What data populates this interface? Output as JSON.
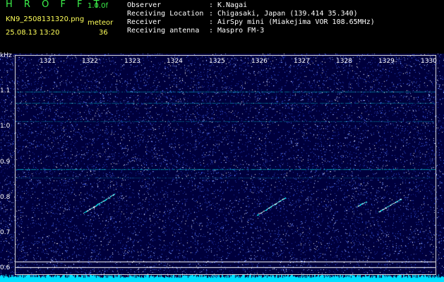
{
  "header": {
    "app_title": "H R O F F T",
    "version": "1.0.0f",
    "filename": "KN9_2508131320.png",
    "meteor_label": "meteor",
    "datetime": "25.08.13 13:20",
    "meteor_count": "36",
    "info": [
      {
        "label": "Observer",
        "value": "K.Nagai"
      },
      {
        "label": "Receiving Location",
        "value": "Chigasaki, Japan (139.414 35.340)"
      },
      {
        "label": "Receiver",
        "value": "AirSpy mini (Miakejima VOR 108.65MHz)"
      },
      {
        "label": "Receiving antenna",
        "value": "Maspro FM-3"
      }
    ]
  },
  "spectrogram": {
    "y_unit": "kHz",
    "y_ticks": [
      "1.1",
      "1.0",
      "0.9",
      "0.8",
      "0.7",
      "0.6"
    ],
    "x_ticks": [
      "1321",
      "1322",
      "1323",
      "1324",
      "1325",
      "1326",
      "1327",
      "1328",
      "1329",
      "1330"
    ],
    "colors": {
      "background": "#00003c",
      "noise": "#4a6cff",
      "signal": "#00ffff",
      "band": "#00e0ff"
    }
  }
}
